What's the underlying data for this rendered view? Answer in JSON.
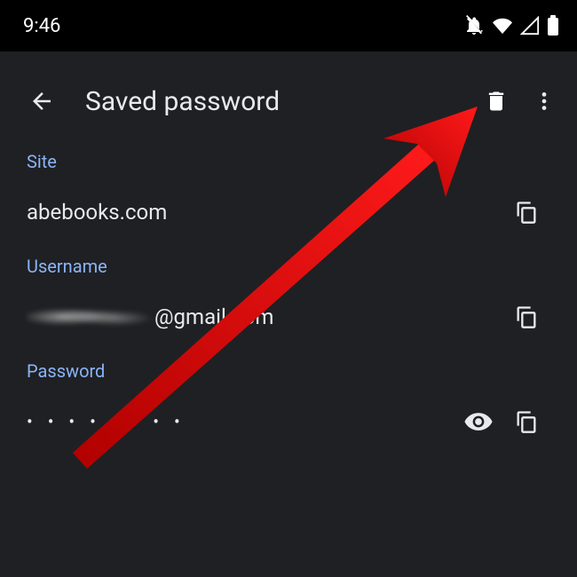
{
  "status": {
    "time": "9:46"
  },
  "header": {
    "title": "Saved password"
  },
  "site": {
    "label": "Site",
    "value": "abebooks.com"
  },
  "username": {
    "label": "Username",
    "suffix": "@gmail.com"
  },
  "password": {
    "label": "Password",
    "masked": "• • • • • • • •"
  }
}
